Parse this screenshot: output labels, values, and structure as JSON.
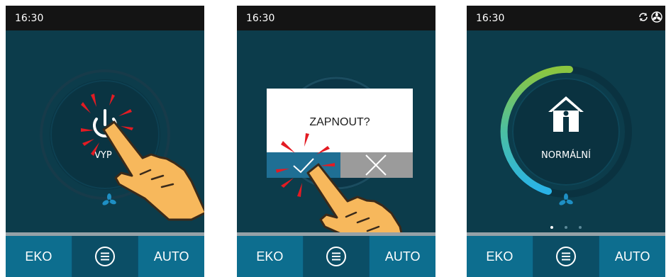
{
  "status_bar": {
    "time": "16:30"
  },
  "bottom_bar": {
    "eko_label": "EKO",
    "auto_label": "AUTO"
  },
  "screen1": {
    "power_label": "VYP"
  },
  "screen2": {
    "dialog_title": "ZAPNOUT?"
  },
  "screen3": {
    "mode_label": "NORMÁLNÍ",
    "page_indicator": {
      "current": 1,
      "total": 3
    }
  },
  "icons": {
    "menu": "menu-icon",
    "power": "power-icon",
    "fan": "fan-icon",
    "home": "home-icon",
    "sync": "sync-icon",
    "fan_status": "fan-status-icon",
    "check": "check-icon",
    "close": "close-icon",
    "hand": "hand-pointer-icon"
  },
  "colors": {
    "screen_bg": "#0c3c4b",
    "status_bar": "#141414",
    "bottom_button": "#0d6e8f",
    "bottom_button_active": "#0b4e66",
    "accent_fan": "#1e8fc4",
    "gauge_green": "#8cc63f",
    "gauge_blue": "#29b3e8",
    "highlight_red": "#e31b23",
    "hand_fill": "#f7b85c",
    "dialog_ok": "#1f6f94",
    "dialog_cancel": "#9b9b9b"
  }
}
